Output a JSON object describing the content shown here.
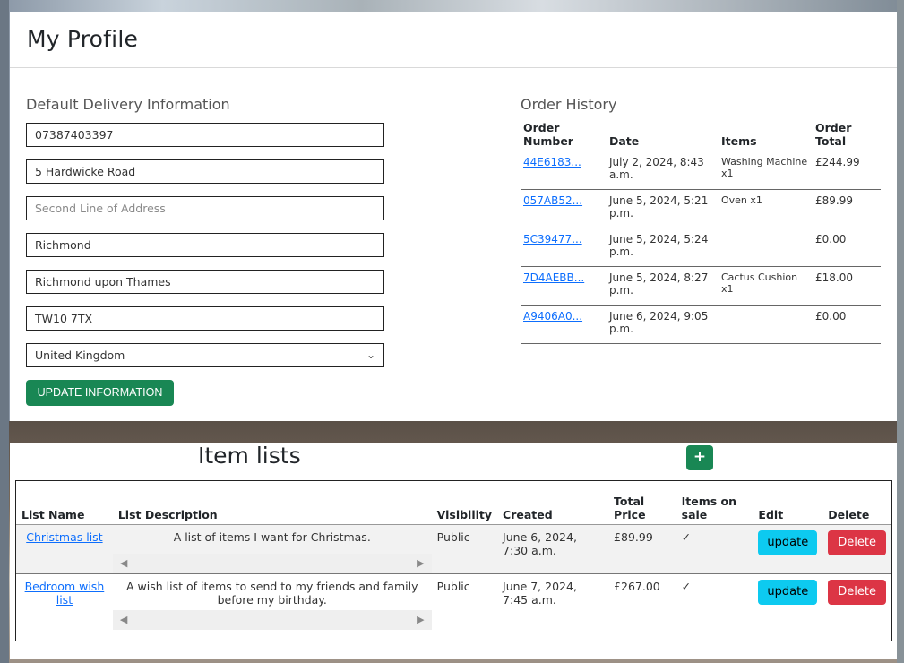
{
  "profile": {
    "title": "My Profile",
    "delivery_heading": "Default Delivery Information",
    "phone": "07387403397",
    "address1": "5 Hardwicke Road",
    "address2_placeholder": "Second Line of Address",
    "town": "Richmond",
    "county": "Richmond upon Thames",
    "postcode": "TW10 7TX",
    "country": "United Kingdom",
    "update_button": "UPDATE INFORMATION"
  },
  "orders": {
    "heading": "Order History",
    "headers": [
      "Order Number",
      "Date",
      "Items",
      "Order Total"
    ],
    "rows": [
      {
        "number": "44E6183...",
        "date": "July 2, 2024, 8:43 a.m.",
        "items": "Washing Machine x1",
        "total": "£244.99"
      },
      {
        "number": "057AB52...",
        "date": "June 5, 2024, 5:21 p.m.",
        "items": "Oven x1",
        "total": "£89.99"
      },
      {
        "number": "5C39477...",
        "date": "June 5, 2024, 5:24 p.m.",
        "items": "",
        "total": "£0.00"
      },
      {
        "number": "7D4AEBB...",
        "date": "June 5, 2024, 8:27 p.m.",
        "items": "Cactus Cushion x1",
        "total": "£18.00"
      },
      {
        "number": "A9406A0...",
        "date": "June 6, 2024, 9:05 p.m.",
        "items": "",
        "total": "£0.00"
      }
    ]
  },
  "item_lists": {
    "title": "Item lists",
    "add_label": "+",
    "headers": [
      "List Name",
      "List Description",
      "Visibility",
      "Created",
      "Total Price",
      "Items on sale",
      "Edit",
      "Delete"
    ],
    "rows": [
      {
        "name": "Christmas list",
        "description": "A list of items I want for Christmas.",
        "visibility": "Public",
        "created": "June 6, 2024, 7:30 a.m.",
        "price": "£89.99",
        "on_sale": "✓",
        "edit": "update",
        "delete": "Delete"
      },
      {
        "name": "Bedroom wish list",
        "description": "A wish list of items to send to my friends and family before my birthday.",
        "visibility": "Public",
        "created": "June 7, 2024, 7:45 a.m.",
        "price": "£267.00",
        "on_sale": "✓",
        "edit": "update",
        "delete": "Delete"
      }
    ]
  },
  "colors": {
    "success": "#198754",
    "info": "#0dcaf0",
    "danger": "#dc3545",
    "link": "#0d6efd"
  }
}
